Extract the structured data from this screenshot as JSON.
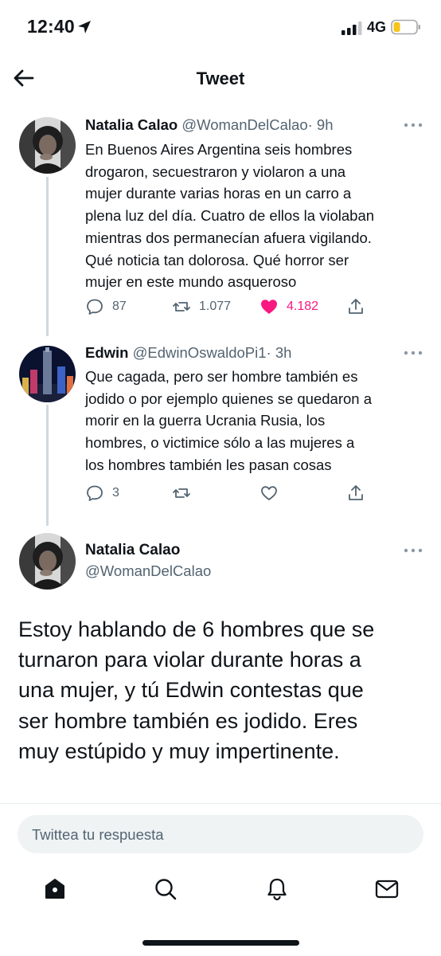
{
  "status_bar": {
    "time": "12:40",
    "network": "4G",
    "battery_color": "#f5c518"
  },
  "header": {
    "title": "Tweet"
  },
  "tweets": [
    {
      "name": "Natalia Calao",
      "handle": "@WomanDelCalao",
      "time": "· 9h",
      "lines": [
        "En Buenos Aires Argentina seis hombres",
        "drogaron, secuestraron y violaron a una",
        "mujer durante varias horas en un carro a",
        "plena luz del día. Cuatro de ellos la violaban",
        "mientras dos permanecían afuera vigilando.",
        "Qué noticia tan dolorosa. Qué horror ser",
        "mujer en este mundo asqueroso"
      ],
      "replies": "87",
      "retweets": "1.077",
      "likes": "4.182"
    },
    {
      "name": "Edwin",
      "handle": "@EdwinOswaldoPi1",
      "time": "· 3h",
      "lines": [
        "Que cagada, pero ser hombre también es",
        "jodido o por ejemplo quienes se quedaron a",
        "morir en la guerra Ucrania Rusia, los",
        "hombres,  o victimice sólo a las mujeres a",
        "los hombres también les pasan cosas"
      ],
      "replies": "3"
    }
  ],
  "main_tweet": {
    "name": "Natalia Calao",
    "handle": "@WomanDelCalao",
    "lines": [
      "Estoy hablando de 6 hombres que se",
      "turnaron para violar durante horas a",
      "una mujer, y tú Edwin contestas que",
      "ser hombre también es jodido. Eres",
      "muy estúpido y muy impertinente."
    ]
  },
  "reply": {
    "placeholder": "Twittea tu respuesta"
  },
  "tabs": [
    "home-icon",
    "search-icon",
    "notifications-icon",
    "messages-icon"
  ],
  "colors": {
    "like": "#f91880",
    "text": "#0f1419",
    "secondary": "#536471"
  }
}
